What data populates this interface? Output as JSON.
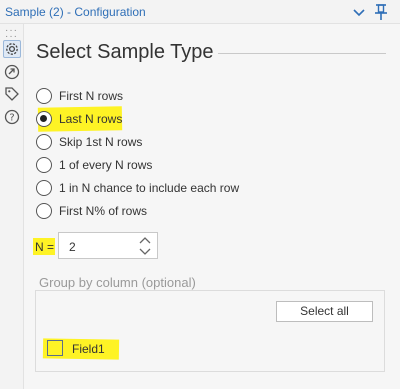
{
  "window": {
    "title": "Sample (2) - Configuration"
  },
  "rail": {
    "icons": [
      "settings-icon",
      "navigate-icon",
      "tag-icon",
      "help-icon"
    ],
    "active": "settings-icon"
  },
  "main": {
    "heading": "Select Sample Type",
    "options": [
      {
        "label": "First N rows",
        "selected": false
      },
      {
        "label": "Last N rows",
        "selected": true
      },
      {
        "label": "Skip 1st N rows",
        "selected": false
      },
      {
        "label": "1 of every N rows",
        "selected": false
      },
      {
        "label": "1 in N chance to include each row",
        "selected": false
      },
      {
        "label": "First N% of rows",
        "selected": false
      }
    ],
    "n_field": {
      "label": "N =",
      "value": "2"
    },
    "group_by": {
      "title": "Group by column (optional)",
      "select_all_label": "Select all",
      "fields": [
        {
          "label": "Field1",
          "checked": false
        }
      ]
    }
  },
  "colors": {
    "title_text": "#2f6fb7",
    "highlight": "#fff200",
    "panel_bg": "#f6f6f6",
    "chrome_bg": "#f3f3f3"
  }
}
